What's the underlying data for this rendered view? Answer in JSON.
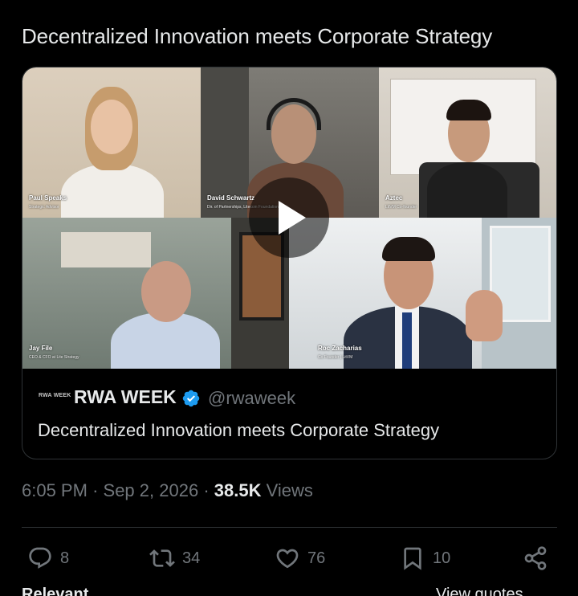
{
  "tweet": {
    "text": "Decentralized Innovation meets Corporate Strategy"
  },
  "video": {
    "participants": [
      {
        "name": "Paul Speaks",
        "title": "Strategic Advisor"
      },
      {
        "name": "David Schwartz",
        "title": "Dir. of Partnerships, Litecoin Foundation"
      },
      {
        "name": "Aztec",
        "title": "LitVM Co-founder"
      },
      {
        "name": "Jay File",
        "title": "CEO & CFO at Lite Strategy"
      },
      {
        "name": "Roc Zacharias",
        "title": "Co Founder | LitVM"
      }
    ],
    "play_icon": "play-icon"
  },
  "card": {
    "logo_text": "RWA WEEK",
    "name": "RWA WEEK",
    "handle": "@rwaweek",
    "description": "Decentralized Innovation meets Corporate Strategy",
    "verified_color": "#1d9bf0"
  },
  "meta": {
    "time": "6:05 PM",
    "separator": "·",
    "date": "Sep 2, 2026",
    "views_count": "38.5K",
    "views_label": "Views"
  },
  "actions": {
    "reply_count": "8",
    "retweet_count": "34",
    "like_count": "76",
    "bookmark_count": "10"
  },
  "bottom": {
    "left_label": "Relevant",
    "right_label": "View quotes"
  },
  "colors": {
    "background": "#000000",
    "text": "#e7e9ea",
    "muted": "#71767b",
    "border": "#2f3336",
    "accent": "#1d9bf0"
  }
}
